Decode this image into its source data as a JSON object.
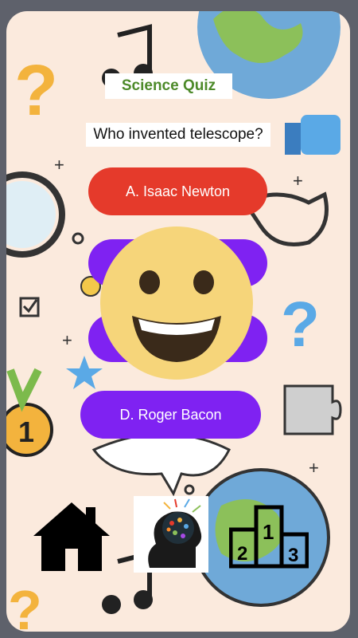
{
  "quiz": {
    "title": "Science Quiz",
    "question": "Who invented telescope?"
  },
  "answers": [
    {
      "label": "A. Isaac Newton",
      "color": "#e53a2b"
    },
    {
      "label": "",
      "color": "#7f22f2"
    },
    {
      "label": "",
      "color": "#7f22f2"
    },
    {
      "label": "D. Roger Bacon",
      "color": "#7f22f2"
    }
  ],
  "overlay": {
    "icon": "grinning-face-emoji-icon"
  },
  "nav": {
    "home_icon": "home-icon",
    "brain_icon": "brain-icon",
    "leaderboard_icon": "podium-icon",
    "podium_labels": [
      "1",
      "2",
      "3"
    ]
  },
  "colors": {
    "background": "#fbeadd",
    "title_text": "#4d8a2a",
    "answer_red": "#e53a2b",
    "answer_purple": "#7f22f2",
    "emoji_face": "#f6d57a"
  }
}
